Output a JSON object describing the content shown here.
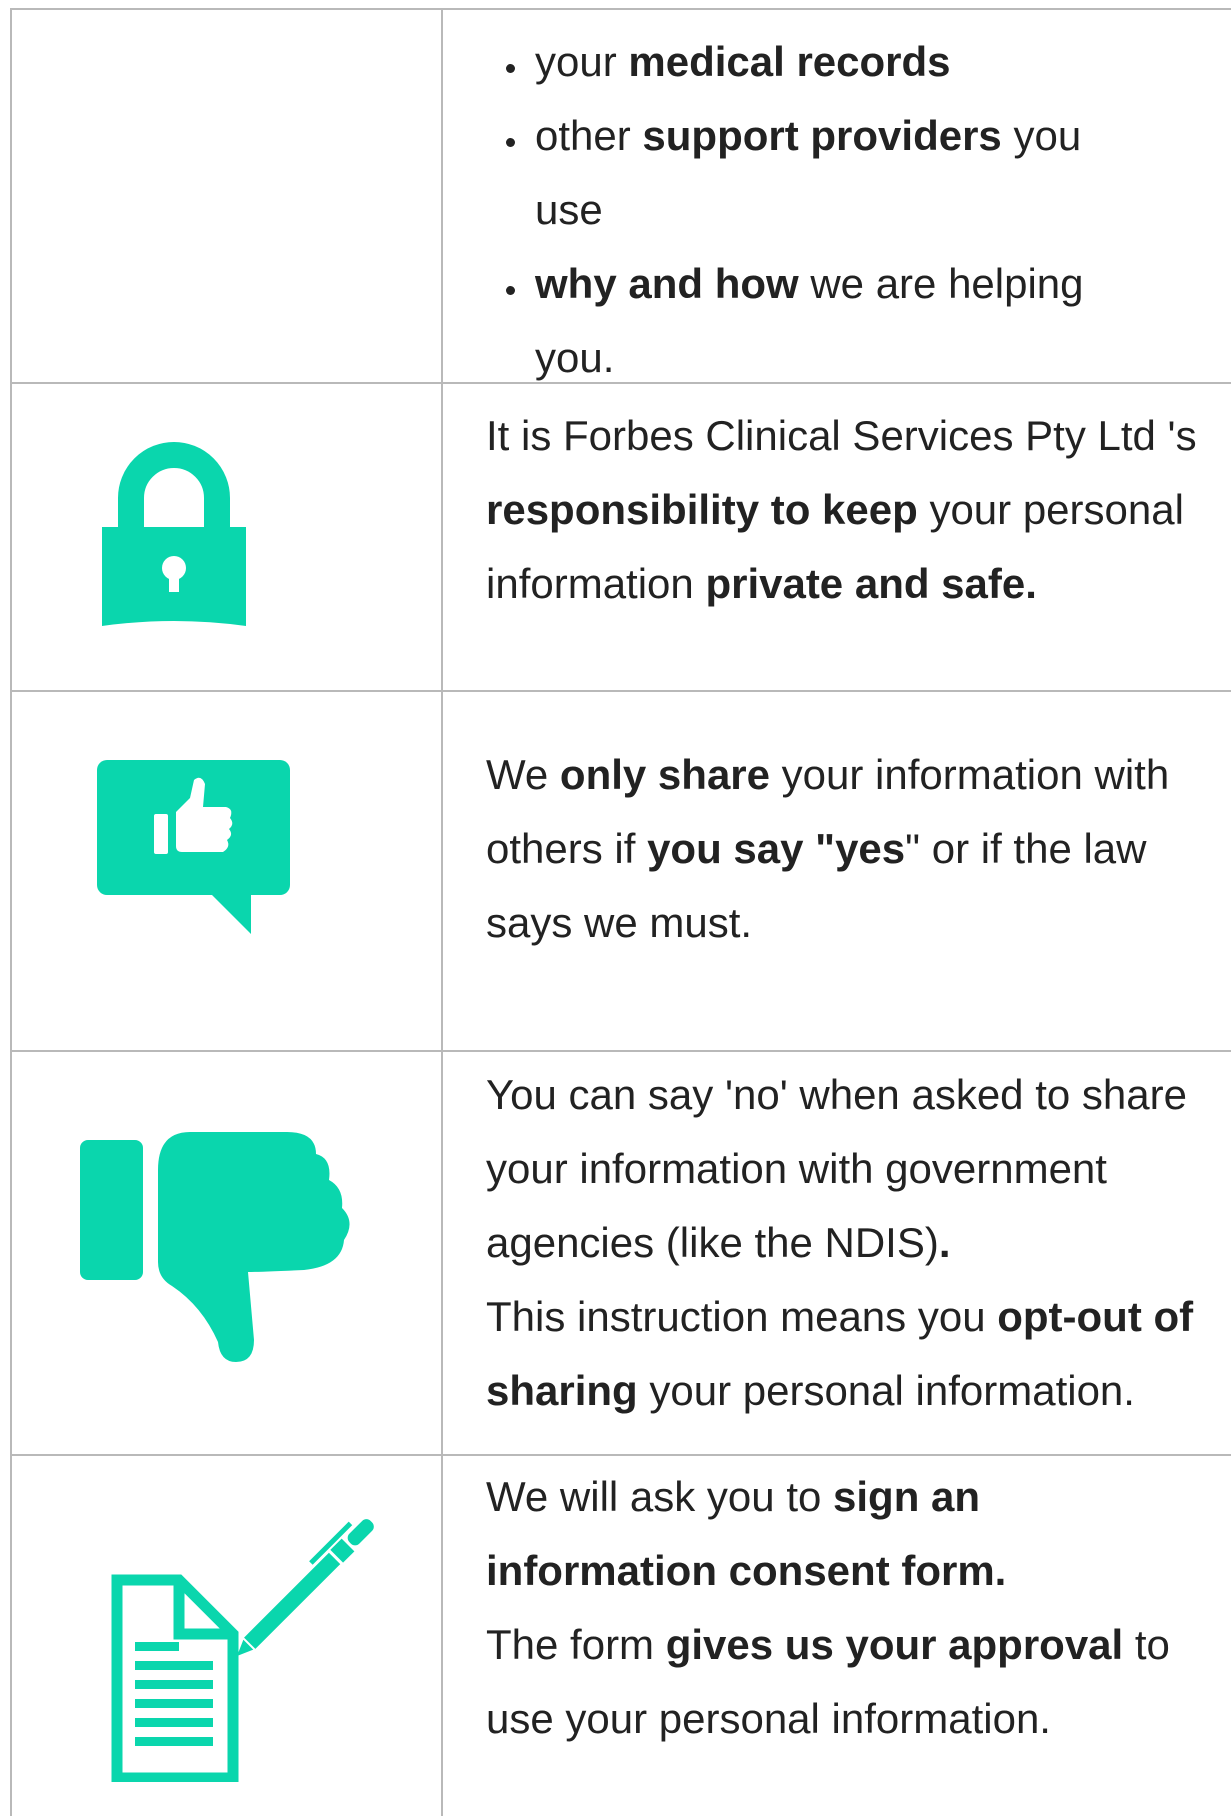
{
  "colors": {
    "accent": "#0ad6ad",
    "border": "#b9b9b9",
    "text": "#222222"
  },
  "row1": {
    "bullets": [
      {
        "pre": "your ",
        "bold": "medical records",
        "post": "",
        "line2": ""
      },
      {
        "pre": "other ",
        "bold": "support providers",
        "post": " you",
        "line2": "use"
      },
      {
        "pre": "",
        "bold": "why and how",
        "post": " we are helping",
        "line2": "you."
      }
    ]
  },
  "row2": {
    "icon": "padlock-icon",
    "l1": "It is Forbes Clinical Services Pty Ltd 's",
    "l2_bold": "responsibility to keep",
    "l2_rest": " your personal",
    "l3_pre": "information ",
    "l3_bold": "private and safe."
  },
  "row3": {
    "icon": "thumbs-up-speech-bubble-icon",
    "l1_pre": "We ",
    "l1_bold": "only share",
    "l1_post": " your information with",
    "l2_pre": "others if ",
    "l2_bold": "you say \"yes",
    "l2_post": "\" or if the law",
    "l3": "says we must."
  },
  "row4": {
    "icon": "thumbs-down-icon",
    "l1": "You can say 'no' when asked to share",
    "l2": "your information with government",
    "l3_pre": "agencies (like the NDIS)",
    "l3_bold": ".",
    "l4_pre": "This instruction means you ",
    "l4_bold": "opt-out of",
    "l5_bold": "sharing",
    "l5_post": " your personal information."
  },
  "row5": {
    "icon": "document-pen-icon",
    "l1_pre": "We will ask you to ",
    "l1_bold": "sign an",
    "l2_bold": "information consent form.",
    "l3_pre": "The form ",
    "l3_bold": "gives us your approval",
    "l3_post": " to",
    "l4": "use your personal information."
  }
}
